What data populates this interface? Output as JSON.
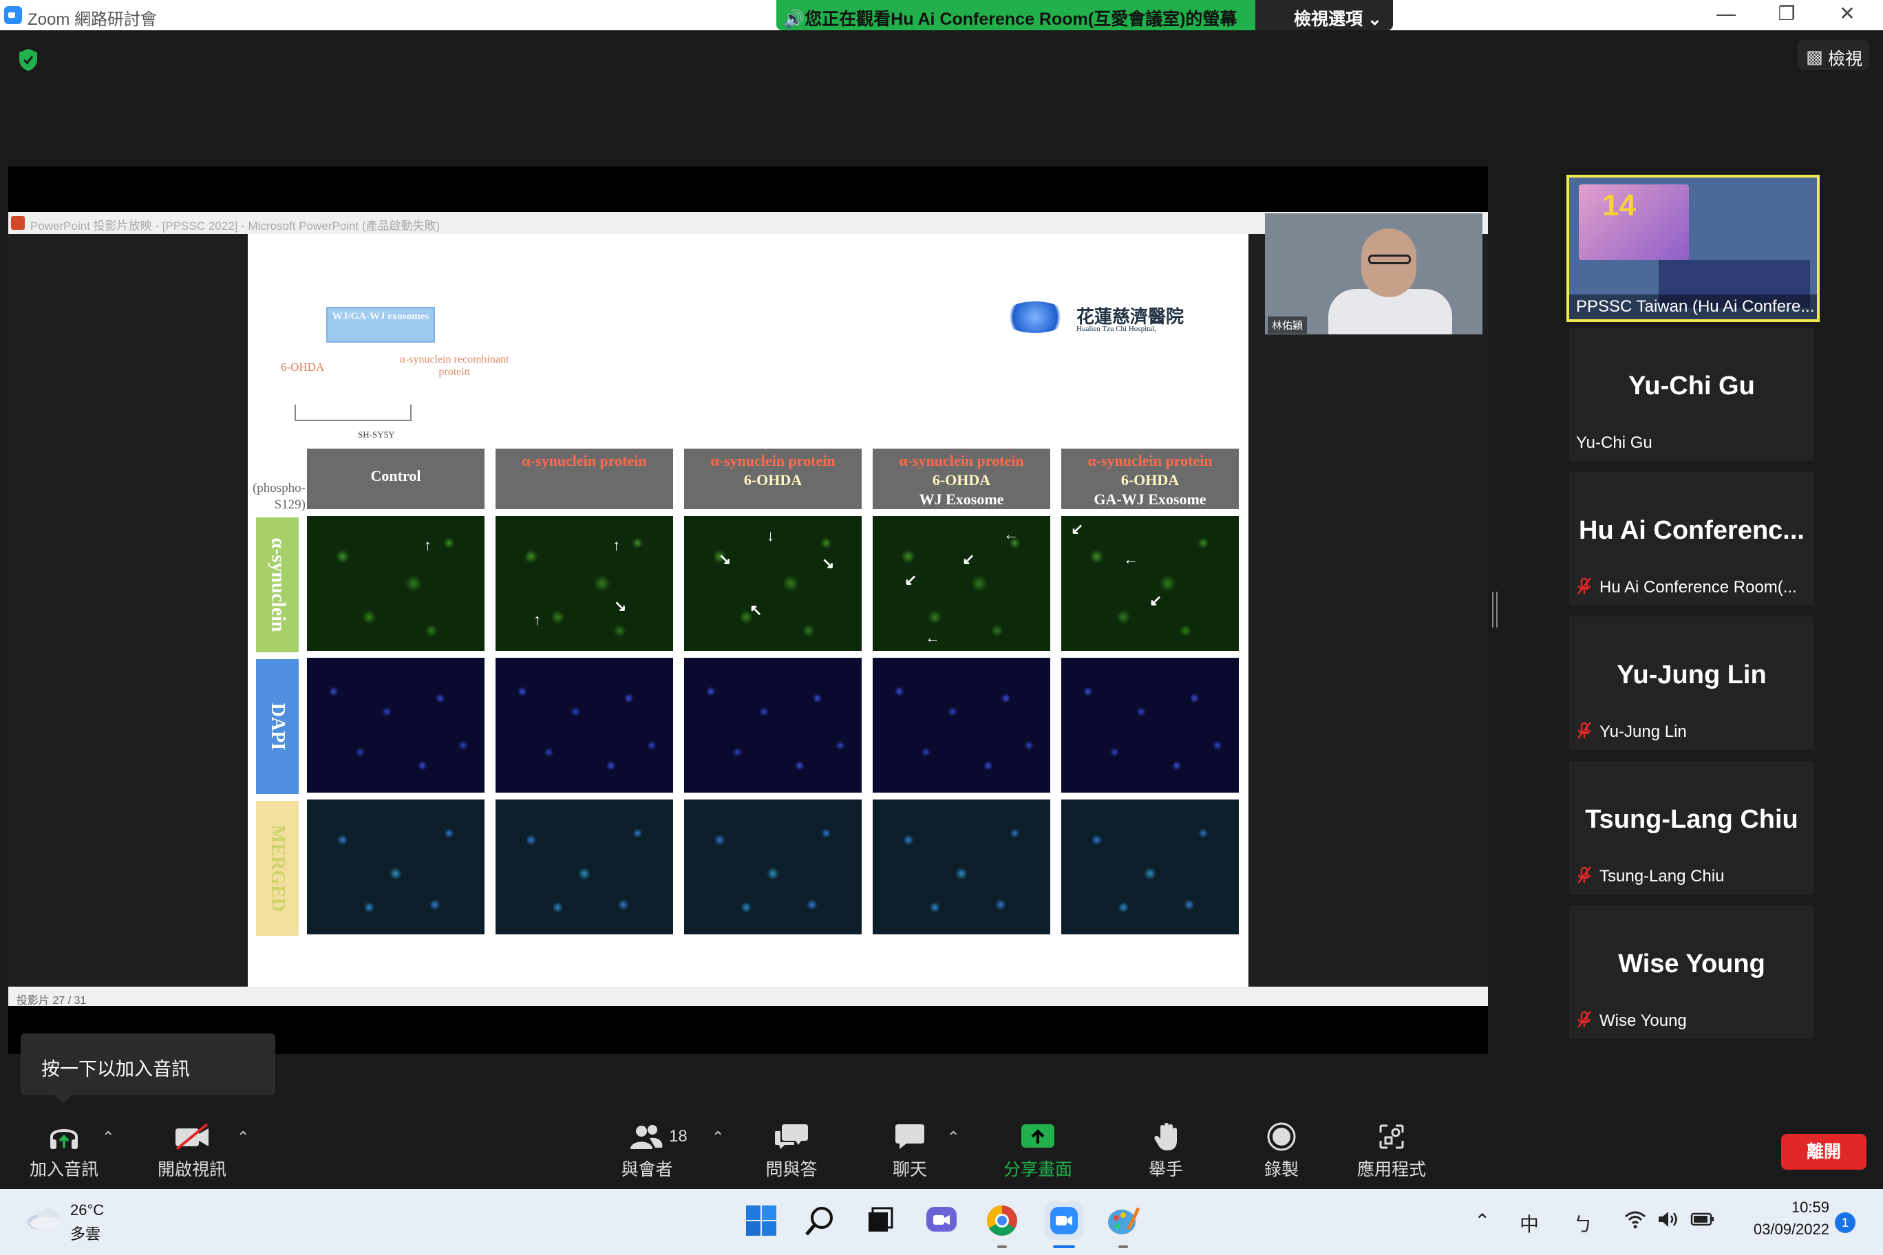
{
  "window": {
    "app_title": "Zoom 網路研討會",
    "viewing_banner": "您正在觀看Hu Ai Conference Room(互愛會議室)的螢幕",
    "view_options": "檢視選項",
    "view_button": "檢視"
  },
  "shared_screen": {
    "ppt_title": "PowerPoint 投影片放映 - [PPSSC 2022] - Microsoft PowerPoint (產品啟動失敗)",
    "status": "投影片 27 / 31",
    "slide": {
      "box_label": "WJ/GA-WJ exosomes",
      "ohda_label": "6-OHDA",
      "recombinant_label": "α-synuclein recombinant protein",
      "cell_line": "SH-SY5Y",
      "phospho_label": "(phospho-S129)",
      "hospital_zh": "花蓮慈濟醫院",
      "hospital_en": "Hualien Tzu Chi Hospital,",
      "columns": [
        {
          "line1": "Control",
          "line2": "",
          "line3": ""
        },
        {
          "line1": "α-synuclein protein",
          "line2": "",
          "line3": ""
        },
        {
          "line1": "α-synuclein protein",
          "line2": "6-OHDA",
          "line3": ""
        },
        {
          "line1": "α-synuclein protein",
          "line2": "6-OHDA",
          "line3": "WJ Exosome"
        },
        {
          "line1": "α-synuclein protein",
          "line2": "6-OHDA",
          "line3": "GA-WJ Exosome"
        }
      ],
      "rows": [
        "α-synuclein",
        "DAPI",
        "MERGED"
      ]
    },
    "speaker_name": "林佑穎"
  },
  "participants": {
    "active": "PPSSC Taiwan (Hu Ai Confere...",
    "list": [
      {
        "big": "Yu-Chi Gu",
        "small": "Yu-Chi Gu",
        "muted": false
      },
      {
        "big": "Hu Ai Conferenc...",
        "small": "Hu Ai Conference Room(...",
        "muted": true
      },
      {
        "big": "Yu-Jung Lin",
        "small": "Yu-Jung Lin",
        "muted": true
      },
      {
        "big": "Tsung-Lang Chiu",
        "small": "Tsung-Lang Chiu",
        "muted": true
      },
      {
        "big": "Wise Young",
        "small": "Wise Young",
        "muted": true
      }
    ]
  },
  "tooltip": "按一下以加入音訊",
  "toolbar": {
    "join_audio": "加入音訊",
    "start_video": "開啟視訊",
    "participants": "與會者",
    "participant_count": "18",
    "qa": "問與答",
    "chat": "聊天",
    "share_screen": "分享畫面",
    "raise_hand": "舉手",
    "record": "錄製",
    "apps": "應用程式",
    "leave": "離開"
  },
  "taskbar": {
    "temperature": "26°C",
    "weather": "多雲",
    "ime_lang": "中",
    "ime_mode": "ㄅ",
    "time": "10:59",
    "date": "03/09/2022",
    "notifications": "1"
  },
  "colors": {
    "zoom_blue": "#2d8cff",
    "banner_green": "#21b04b",
    "leave_red": "#e02828",
    "active_border": "#f2e94e",
    "share_green": "#21b04b"
  }
}
